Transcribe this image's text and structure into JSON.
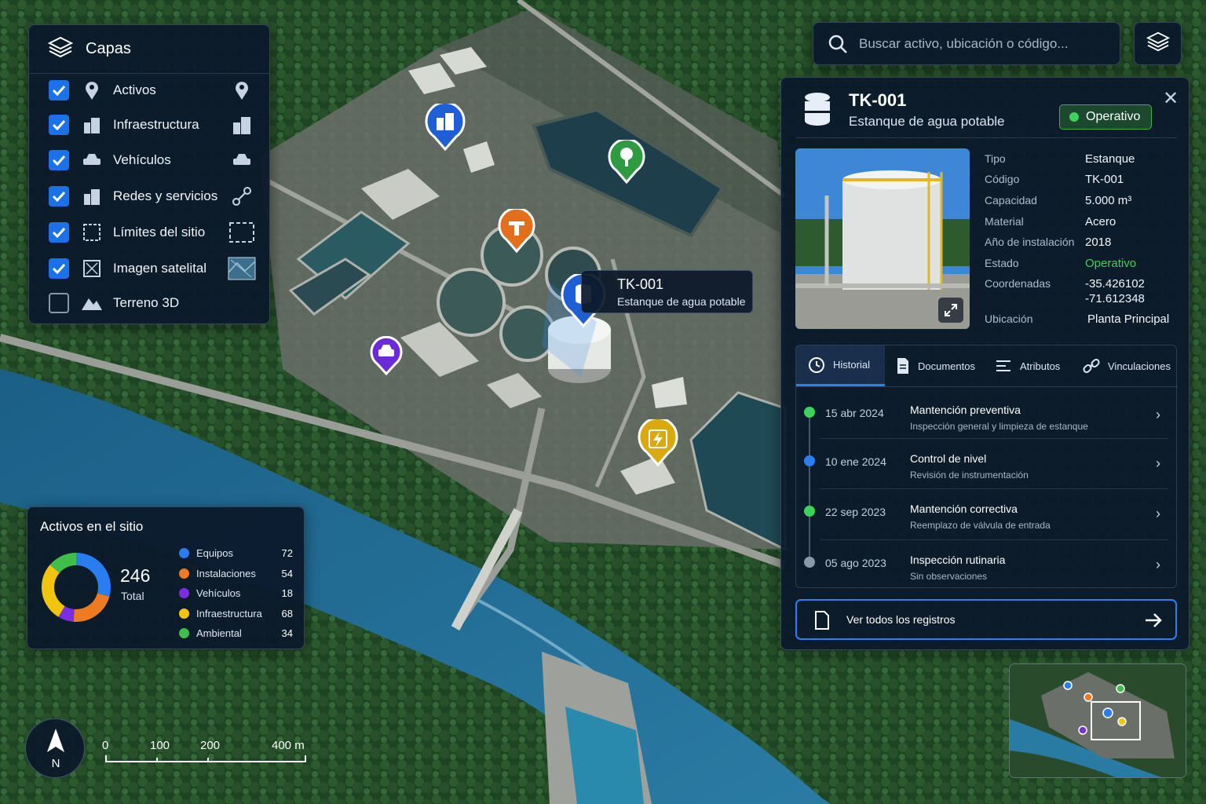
{
  "colors": {
    "accent": "#2b7ff0",
    "panel_bg": "#0c182a",
    "status_green": "#3fd15a",
    "equipos": "#2a7df0",
    "instalaciones": "#ee7a22",
    "vehiculos": "#7a2ee0",
    "infraestructura": "#f1c40f",
    "ambiental": "#3fbf4a"
  },
  "layers": {
    "title": "Capas",
    "items": [
      {
        "label": "Activos",
        "checked": true,
        "icon": "map-pin-icon",
        "right_icon": "map-pin-icon"
      },
      {
        "label": "Infraestructura",
        "checked": true,
        "icon": "buildings-icon",
        "right_icon": "buildings-icon"
      },
      {
        "label": "Vehículos",
        "checked": true,
        "icon": "car-icon",
        "right_icon": "car-icon"
      },
      {
        "label": "Redes y servicios",
        "checked": true,
        "icon": "network-buildings-icon",
        "right_icon": "network-nodes-icon"
      },
      {
        "label": "Límites del sitio",
        "checked": true,
        "icon": "boundary-square-icon",
        "right_icon": "dashed-boundary-icon"
      },
      {
        "label": "Imagen satelital",
        "checked": true,
        "icon": "satellite-image-icon",
        "right_icon": "satellite-thumbnail-icon"
      },
      {
        "label": "Terreno 3D",
        "checked": false,
        "icon": "mountain-icon"
      }
    ]
  },
  "search": {
    "placeholder": "Buscar activo, ubicación o código..."
  },
  "map_tooltip": {
    "code": "TK-001",
    "name": "Estanque de agua potable"
  },
  "detail": {
    "code": "TK-001",
    "name": "Estanque de agua potable",
    "status": "Operativo",
    "attributes": [
      {
        "label": "Tipo",
        "value": "Estanque"
      },
      {
        "label": "Código",
        "value": "TK-001"
      },
      {
        "label": "Capacidad",
        "value": "5.000 m³"
      },
      {
        "label": "Material",
        "value": "Acero"
      },
      {
        "label": "Año de instalación",
        "value": "2018"
      },
      {
        "label": "Estado",
        "value": "Operativo"
      },
      {
        "label": "Coordenadas",
        "value": "-35.426102"
      },
      {
        "label": "",
        "value": "-71.612348"
      },
      {
        "label": "Ubicación",
        "value": "Planta Principal"
      }
    ],
    "tabs": [
      "Historial",
      "Documentos",
      "Atributos",
      "Vinculaciones"
    ],
    "active_tab": "Historial",
    "history": [
      {
        "date": "15 abr 2024",
        "title": "Mantención preventiva",
        "desc": "Inspección general y limpieza de estanque",
        "dot": "#3fd15a"
      },
      {
        "date": "10 ene 2024",
        "title": "Control de nivel",
        "desc": "Revisión de instrumentación",
        "dot": "#2b7ff0"
      },
      {
        "date": "22 sep 2023",
        "title": "Mantención correctiva",
        "desc": "Reemplazo de válvula de entrada",
        "dot": "#3fd15a"
      },
      {
        "date": "05 ago 2023",
        "title": "Inspección rutinaria",
        "desc": "Sin observaciones",
        "dot": "#8a98ad"
      }
    ],
    "view_all": "Ver todos los registros"
  },
  "assets": {
    "title": "Activos en el sitio",
    "total": "246",
    "total_label": "Total",
    "legend": [
      {
        "name": "Equipos",
        "value": "72"
      },
      {
        "name": "Instalaciones",
        "value": "54"
      },
      {
        "name": "Vehículos",
        "value": "18"
      },
      {
        "name": "Infraestructura",
        "value": "68"
      },
      {
        "name": "Ambiental",
        "value": "34"
      }
    ],
    "donut_values": [
      72,
      54,
      18,
      68,
      34
    ]
  },
  "compass": {
    "label": "N"
  },
  "scale": {
    "labels": [
      "0",
      "100",
      "200",
      "400 m"
    ]
  }
}
